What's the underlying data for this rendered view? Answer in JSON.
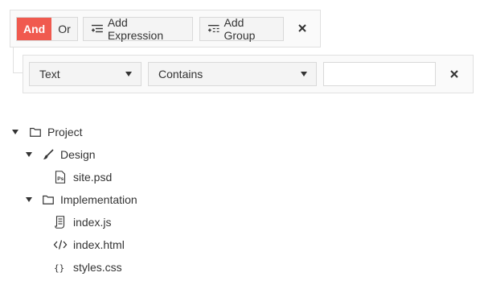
{
  "filter": {
    "group": {
      "operators": [
        "And",
        "Or"
      ],
      "active_operator": "And",
      "add_expression_label": "Add Expression",
      "add_group_label": "Add Group"
    },
    "expression": {
      "field": "Text",
      "operator": "Contains",
      "value": ""
    }
  },
  "tree": {
    "nodes": [
      {
        "label": "Project",
        "icon": "folder-icon",
        "expanded": true,
        "level": 0
      },
      {
        "label": "Design",
        "icon": "brush-icon",
        "expanded": true,
        "level": 1
      },
      {
        "label": "site.psd",
        "icon": "psd-file-icon",
        "level": 2
      },
      {
        "label": "Implementation",
        "icon": "folder-icon",
        "expanded": true,
        "level": 1
      },
      {
        "label": "index.js",
        "icon": "script-file-icon",
        "level": 2
      },
      {
        "label": "index.html",
        "icon": "html-code-icon",
        "level": 2
      },
      {
        "label": "styles.css",
        "icon": "css-braces-icon",
        "level": 2
      }
    ]
  },
  "colors": {
    "accent": "#f05a4f",
    "button_bg": "#f4f4f4",
    "border": "#d9d9d9",
    "group_bg": "#fafafa"
  }
}
